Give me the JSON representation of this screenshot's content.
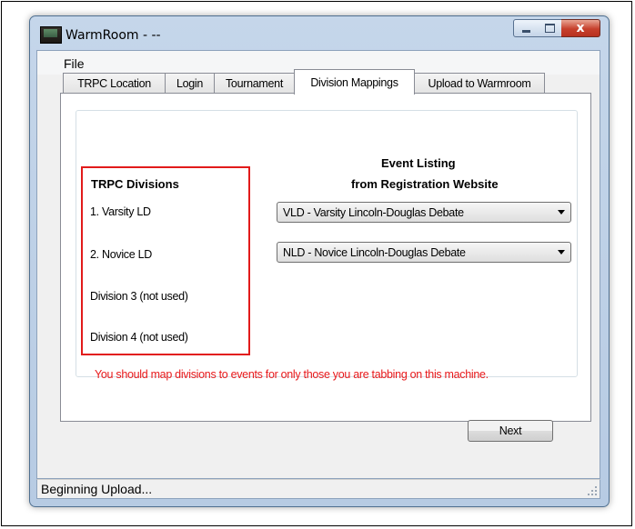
{
  "window": {
    "title": "WarmRoom - --",
    "minimize_glyph": "",
    "close_glyph": "x"
  },
  "menu": {
    "file": "File"
  },
  "tabs": [
    {
      "label": "TRPC Location"
    },
    {
      "label": "Login"
    },
    {
      "label": "Tournament"
    },
    {
      "label": "Division Mappings",
      "active": true
    },
    {
      "label": "Upload to Warmroom"
    }
  ],
  "left_column": {
    "heading": "TRPC Divisions",
    "divisions": [
      "1. Varsity LD",
      "2. Novice LD",
      "Division 3 (not used)",
      "Division 4 (not used)"
    ]
  },
  "right_column": {
    "heading_line1": "Event Listing",
    "heading_line2": "from Registration Website",
    "mappings": [
      "VLD - Varsity Lincoln-Douglas Debate",
      "NLD - Novice Lincoln-Douglas Debate"
    ]
  },
  "warning": "You should map divisions to events for only those you are tabbing on this machine.",
  "next_button": "Next",
  "status": "Beginning Upload...",
  "colors": {
    "warning": "#e8191b",
    "highlight_border": "#e21b1b",
    "close_button": "#c6402c"
  },
  "icons": {
    "app": "warmroom-app-icon",
    "minimize": "minimize-icon",
    "maximize": "maximize-icon",
    "close": "close-icon",
    "dropdown": "chevron-down-icon",
    "resize": "resize-grip-icon"
  }
}
